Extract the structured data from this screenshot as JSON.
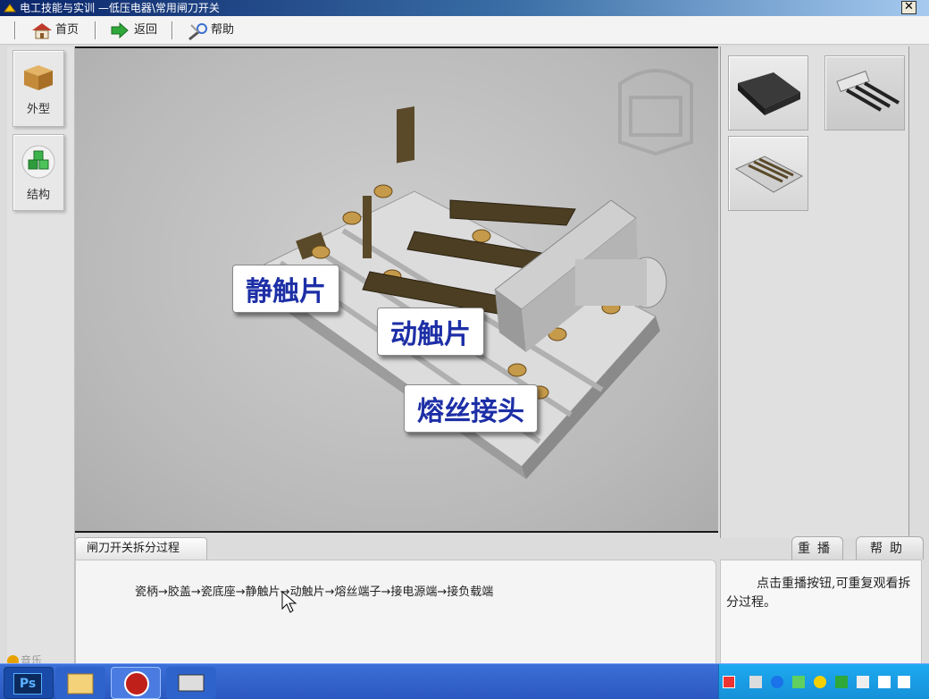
{
  "window": {
    "title": "电工技能与实训 —低压电器\\常用闸刀开关",
    "close": "✕"
  },
  "toolbar": {
    "home": "首页",
    "back": "返回",
    "help": "帮助"
  },
  "sidebar": {
    "items": [
      {
        "label": "外型"
      },
      {
        "label": "结构"
      }
    ],
    "music": "音乐"
  },
  "viewport": {
    "labels": {
      "static_contact": "静触片",
      "moving_contact": "动触片",
      "fuse_terminal": "熔丝接头"
    }
  },
  "process": {
    "tab": "闸刀开关拆分过程",
    "steps": "瓷柄→胶盖→瓷底座→静触片→动触片→熔丝端子→接电源端→接负载端"
  },
  "help_panel": {
    "replay_tab": "重播",
    "help_tab": "帮助",
    "text": "点击重播按钮,可重复观看拆分过程。"
  },
  "taskbar": {
    "ps": "Ps"
  },
  "colors": {
    "label_text": "#1d2fa6",
    "title_bar": "#0a246a",
    "taskbar": "#2a58c0"
  }
}
